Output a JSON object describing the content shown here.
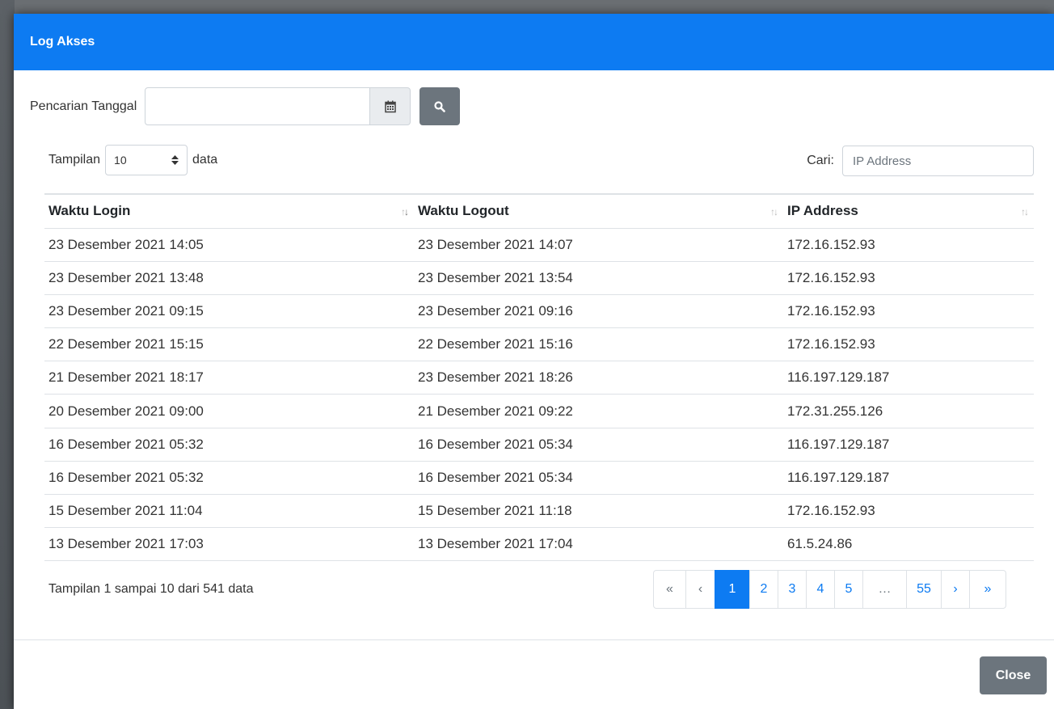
{
  "modal": {
    "title": "Log Akses"
  },
  "search": {
    "label": "Pencarian Tanggal",
    "date_value": "",
    "calendar_icon": "calendar-icon",
    "search_icon": "search-icon"
  },
  "length": {
    "prefix": "Tampilan",
    "value": "10",
    "suffix": "data"
  },
  "filter": {
    "label": "Cari:",
    "placeholder": "IP Address"
  },
  "table": {
    "headers": [
      "Waktu Login",
      "Waktu Logout",
      "IP Address"
    ],
    "rows": [
      [
        "23 Desember 2021 14:05",
        "23 Desember 2021 14:07",
        "172.16.152.93"
      ],
      [
        "23 Desember 2021 13:48",
        "23 Desember 2021 13:54",
        "172.16.152.93"
      ],
      [
        "23 Desember 2021 09:15",
        "23 Desember 2021 09:16",
        "172.16.152.93"
      ],
      [
        "22 Desember 2021 15:15",
        "22 Desember 2021 15:16",
        "172.16.152.93"
      ],
      [
        "21 Desember 2021 18:17",
        "23 Desember 2021 18:26",
        "116.197.129.187"
      ],
      [
        "20 Desember 2021 09:00",
        "21 Desember 2021 09:22",
        "172.31.255.126"
      ],
      [
        "16 Desember 2021 05:32",
        "16 Desember 2021 05:34",
        "116.197.129.187"
      ],
      [
        "16 Desember 2021 05:32",
        "16 Desember 2021 05:34",
        "116.197.129.187"
      ],
      [
        "15 Desember 2021 11:04",
        "15 Desember 2021 11:18",
        "172.16.152.93"
      ],
      [
        "13 Desember 2021 17:03",
        "13 Desember 2021 17:04",
        "61.5.24.86"
      ]
    ]
  },
  "info": "Tampilan 1 sampai 10 dari 541 data",
  "pagination": {
    "first": "«",
    "prev": "‹",
    "pages": [
      "1",
      "2",
      "3",
      "4",
      "5",
      "…",
      "55"
    ],
    "next": "›",
    "last": "»",
    "active": "1"
  },
  "footer": {
    "close_label": "Close"
  },
  "colors": {
    "primary": "#0d7bf2",
    "secondary": "#6c757d"
  }
}
